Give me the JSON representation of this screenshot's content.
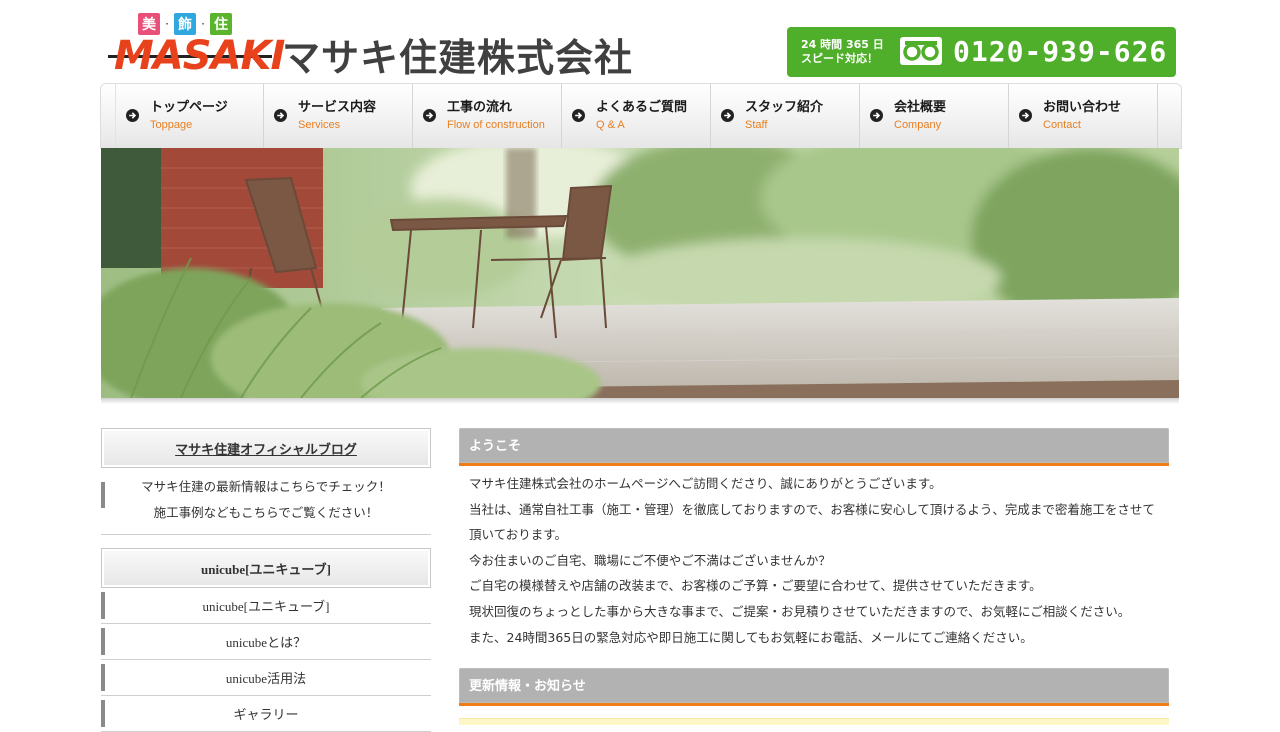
{
  "header": {
    "logo_kanji": [
      "美",
      "飾",
      "住"
    ],
    "logo_kanji_colors": [
      "#e8507a",
      "#2fa8e0",
      "#5ab42d"
    ],
    "logo_word": "MASAKI",
    "company_name": "マサキ住建株式会社",
    "support_note_line1": "24 時間 365 日",
    "support_note_line2": "スピード対応！",
    "phone_number": "0120-939-626",
    "phone_icon": "free-dial-icon"
  },
  "nav": [
    {
      "jp": "トップページ",
      "en": "Toppage"
    },
    {
      "jp": "サービス内容",
      "en": "Services"
    },
    {
      "jp": "工事の流れ",
      "en": "Flow of construction"
    },
    {
      "jp": "よくあるご質問",
      "en": "Q & A"
    },
    {
      "jp": "スタッフ紹介",
      "en": "Staff"
    },
    {
      "jp": "会社概要",
      "en": "Company"
    },
    {
      "jp": "お問い合わせ",
      "en": "Contact"
    }
  ],
  "sidebar": {
    "blog_title": "マサキ住建オフィシャルブログ",
    "blog_text_1": "マサキ住建の最新情報はこちらでチェック！",
    "blog_text_2": "施工事例などもこちらでご覧ください！",
    "unicube_title": "unicube[ユニキューブ]",
    "items": [
      "unicube[ユニキューブ]",
      "unicubeとは？",
      "unicube活用法",
      "ギャラリー"
    ]
  },
  "main": {
    "welcome_title": "ようこそ",
    "welcome_paragraphs": [
      "マサキ住建株式会社のホームページへご訪問くださり、誠にありがとうございます。",
      "当社は、通常自社工事（施工・管理）を徹底しておりますので、お客様に安心して頂けるよう、完成まで密着施工をさせて頂いております。",
      "今お住まいのご自宅、職場にご不便やご不満はございませんか？",
      "ご自宅の模様替えや店舗の改装まで、お客様のご予算・ご要望に合わせて、提供させていただきます。",
      "現状回復のちょっとした事から大きな事まで、ご提案・お見積りさせていただきますので、お気軽にご相談ください。",
      "また、24時間365日の緊急対応や即日施工に関してもお気軽にお電話、メールにてご連絡ください。"
    ],
    "news_title": "更新情報・お知らせ"
  },
  "colors": {
    "accent_green": "#4fae2a",
    "accent_orange": "#f07d1a",
    "nav_en_orange": "#e87f22",
    "logo_red": "#e8421d",
    "section_gray": "#b2b2b2"
  }
}
